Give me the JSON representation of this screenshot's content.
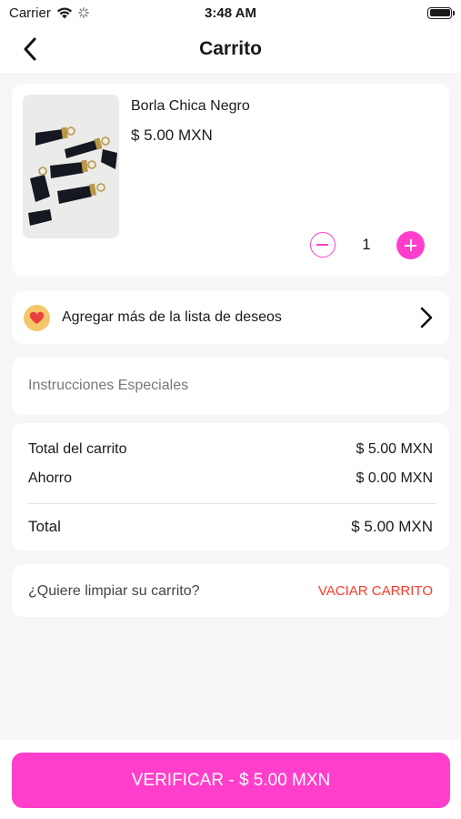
{
  "status_bar": {
    "carrier": "Carrier",
    "time": "3:48 AM",
    "battery_level": 1.0
  },
  "header": {
    "title": "Carrito",
    "back_icon": "chevron-left-icon"
  },
  "cart_item": {
    "name": "Borla Chica Negro",
    "price": "$ 5.00 MXN",
    "quantity": "1",
    "image": "black-tassels-product-photo"
  },
  "wishlist": {
    "label": "Agregar más de la lista de deseos",
    "icon": "heart-icon"
  },
  "instructions": {
    "placeholder": "Instrucciones Especiales",
    "value": ""
  },
  "totals": {
    "cart_total_label": "Total del carrito",
    "cart_total_value": "$ 5.00 MXN",
    "savings_label": "Ahorro",
    "savings_value": "$ 0.00 MXN",
    "total_label": "Total",
    "total_value": "$ 5.00 MXN"
  },
  "clear_cart": {
    "question": "¿Quiere limpiar su carrito?",
    "button_label": "VACIAR CARRITO"
  },
  "checkout": {
    "button_label": "VERIFICAR - $ 5.00 MXN"
  },
  "colors": {
    "accent": "#ff3fcb",
    "danger": "#ff3a2d",
    "heart_badge": "#f5c76a",
    "background": "#f6f6f6"
  }
}
